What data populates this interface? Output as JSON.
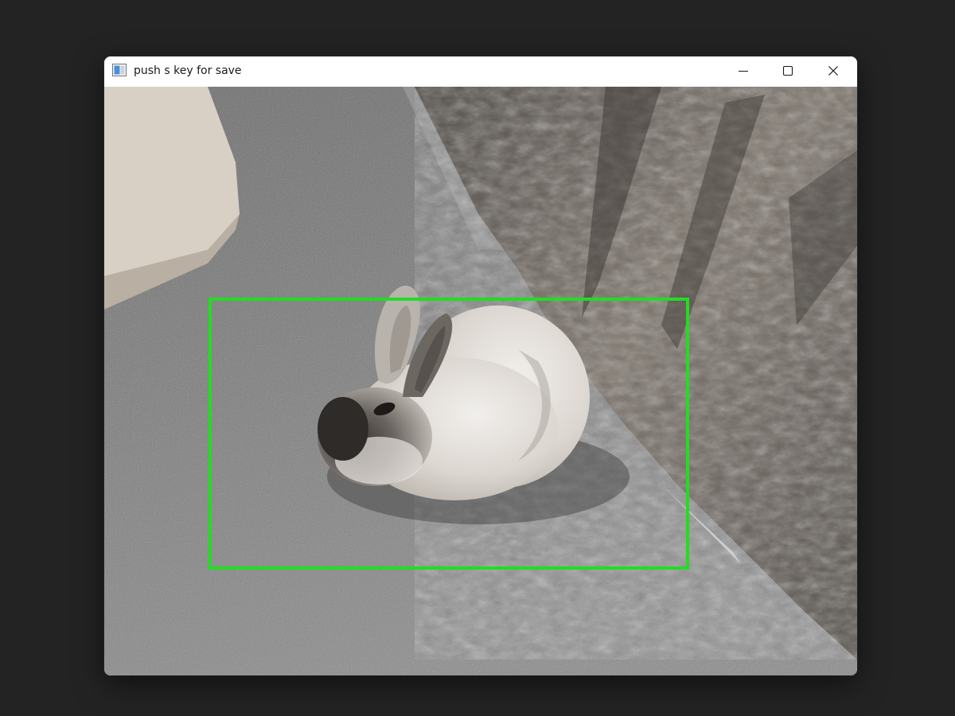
{
  "window": {
    "title": "push s key for save"
  },
  "controls": {
    "minimize_icon": "minimize-icon",
    "maximize_icon": "maximize-icon",
    "close_icon": "close-icon"
  },
  "image": {
    "subject": "rabbit photo",
    "bbox_color": "#22dd22"
  }
}
